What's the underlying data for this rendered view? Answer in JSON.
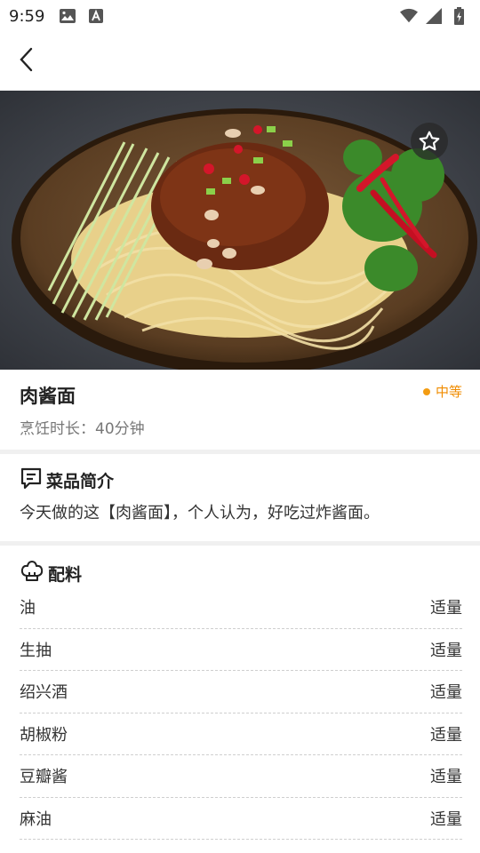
{
  "status_bar": {
    "time": "9:59"
  },
  "app_bar": {
    "back_icon": "chevron-left-icon"
  },
  "hero": {
    "favorite_icon": "star-outline-icon"
  },
  "recipe": {
    "name": "肉酱面",
    "difficulty": "中等",
    "difficulty_color": "#f39c12",
    "cook_time": "烹饪时长：40分钟"
  },
  "intro": {
    "heading": "菜品简介",
    "icon": "chat-text-icon",
    "text": "今天做的这【肉酱面】，个人认为，好吃过炸酱面。"
  },
  "ingredients": {
    "heading": "配料",
    "icon": "chef-hat-icon",
    "items": [
      {
        "name": "油",
        "amount": "适量"
      },
      {
        "name": "生抽",
        "amount": "适量"
      },
      {
        "name": "绍兴酒",
        "amount": "适量"
      },
      {
        "name": "胡椒粉",
        "amount": "适量"
      },
      {
        "name": "豆瓣酱",
        "amount": "适量"
      },
      {
        "name": "麻油",
        "amount": "适量"
      }
    ]
  }
}
